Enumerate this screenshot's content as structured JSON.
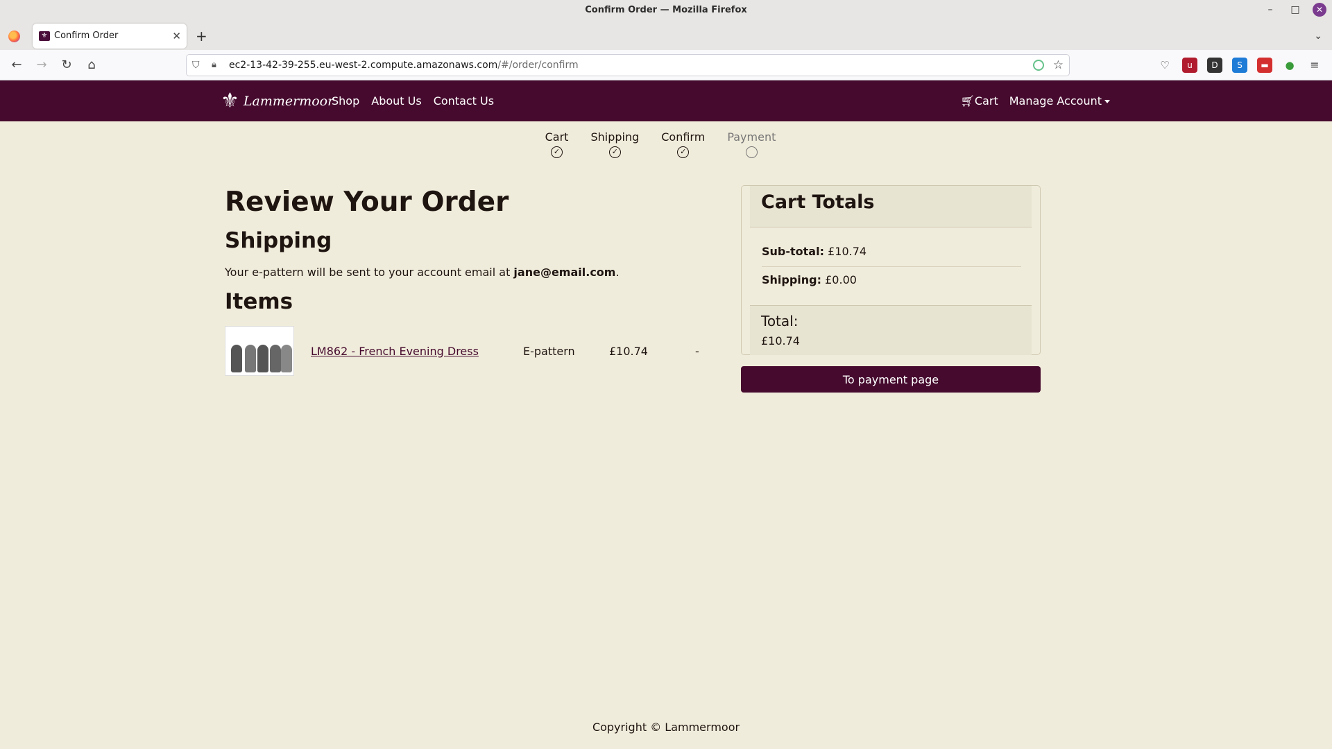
{
  "browser": {
    "window_title": "Confirm Order — Mozilla Firefox",
    "tab_title": "Confirm Order",
    "url_host": "ec2-13-42-39-255.eu-west-2.compute.amazonaws.com",
    "url_path": "/#/order/confirm"
  },
  "site": {
    "brand": "Lammermoor",
    "nav": [
      "Shop",
      "About Us",
      "Contact Us"
    ],
    "cart_label": "Cart",
    "account_label": "Manage Account",
    "accent_color": "#460a2e"
  },
  "steps": [
    {
      "label": "Cart",
      "done": true
    },
    {
      "label": "Shipping",
      "done": true
    },
    {
      "label": "Confirm",
      "done": true
    },
    {
      "label": "Payment",
      "done": false
    }
  ],
  "review": {
    "title": "Review Your Order",
    "shipping_heading": "Shipping",
    "shipping_text_before": "Your e-pattern will be sent to your account email at ",
    "shipping_email": "jane@email.com",
    "shipping_text_after": ".",
    "items_heading": "Items",
    "items": [
      {
        "name": "LM862 - French Evening Dress",
        "type": "E-pattern",
        "price": "£10.74",
        "extra": "-"
      }
    ]
  },
  "totals": {
    "heading": "Cart Totals",
    "subtotal_label": "Sub-total:",
    "subtotal_value": "£10.74",
    "shipping_label": "Shipping:",
    "shipping_value": "£0.00",
    "total_label": "Total:",
    "total_value": "£10.74"
  },
  "actions": {
    "pay_button": "To payment page"
  },
  "footer": {
    "copyright": "Copyright © Lammermoor"
  }
}
